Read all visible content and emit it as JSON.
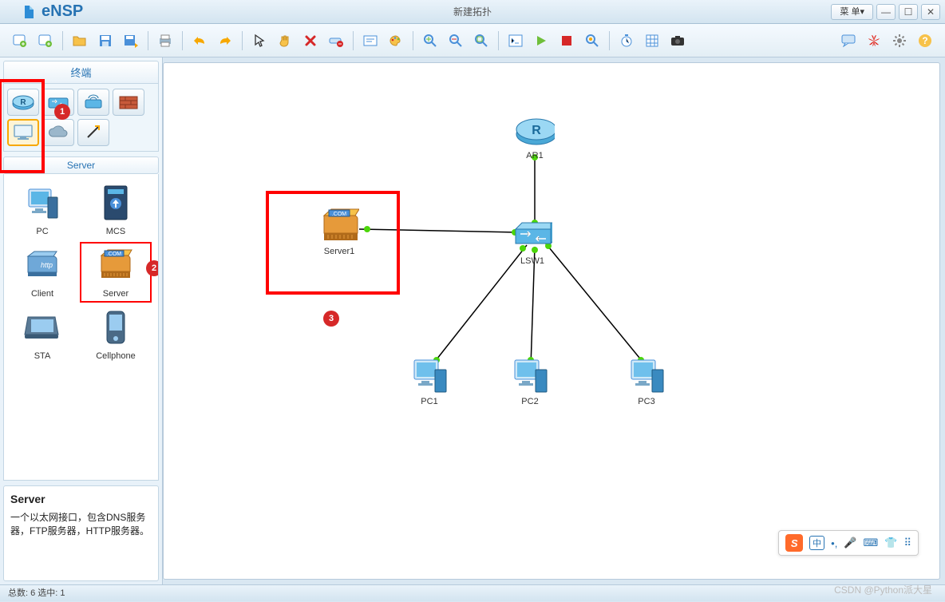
{
  "app": {
    "name": "eNSP",
    "title": "新建拓扑",
    "menu_label": "菜 单▾"
  },
  "sidebar": {
    "title": "终端",
    "category_selected": "Server",
    "devices": [
      {
        "label": "PC"
      },
      {
        "label": "MCS"
      },
      {
        "label": "Client"
      },
      {
        "label": "Server"
      },
      {
        "label": "STA"
      },
      {
        "label": "Cellphone"
      }
    ],
    "desc": {
      "title": "Server",
      "body": "一个以太网接口，包含DNS服务器，FTP服务器，HTTP服务器。"
    }
  },
  "topology": {
    "nodes": {
      "ar1": "AR1",
      "server1": "Server1",
      "lsw1": "LSW1",
      "pc1": "PC1",
      "pc2": "PC2",
      "pc3": "PC3"
    }
  },
  "statusbar": {
    "text": "总数: 6 选中: 1"
  },
  "badge": {
    "b1": "1",
    "b2": "2",
    "b3": "3"
  },
  "watermark": "CSDN @Python派大星"
}
